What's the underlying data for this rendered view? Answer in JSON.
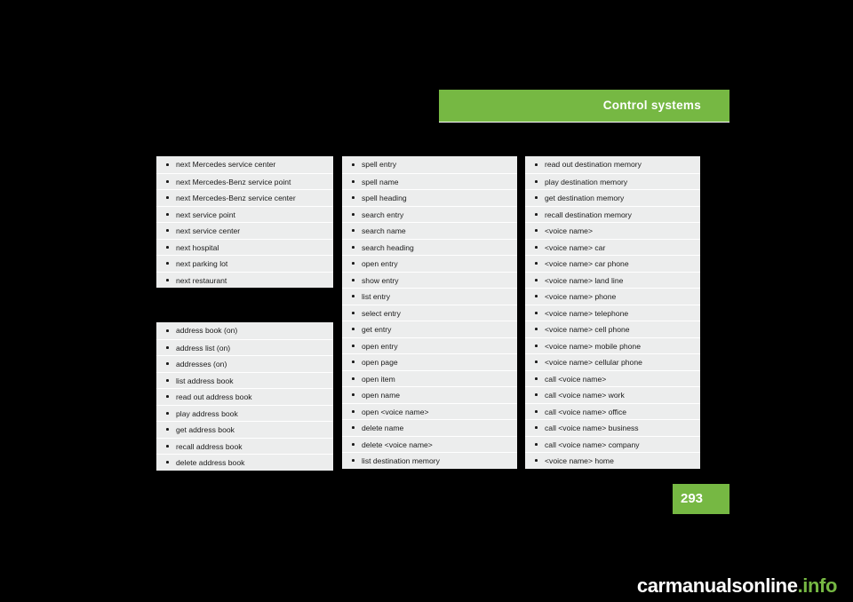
{
  "header": {
    "title": "Control systems"
  },
  "page_number": "293",
  "footer": {
    "text_main": "carmanualsonline",
    "text_suffix": ".info"
  },
  "tables": {
    "navigation_pois": [
      "next Mercedes service center",
      "next Mercedes-Benz service point",
      "next Mercedes-Benz service center",
      "next service point",
      "next service center",
      "next hospital",
      "next parking lot",
      "next restaurant"
    ],
    "address_book": [
      "address book (on)",
      "address list (on)",
      "addresses (on)",
      "list address book",
      "read out address book",
      "play address book",
      "get address book",
      "recall address book",
      "delete address book"
    ],
    "entry_commands": [
      "spell entry",
      "spell name",
      "spell heading",
      "search entry",
      "search name",
      "search heading",
      "open entry",
      "show entry",
      "list entry",
      "select entry",
      "get entry",
      "open entry",
      "open page",
      "open item",
      "open name",
      "open <voice name>",
      "delete name",
      "delete <voice name>",
      "list destination memory"
    ],
    "destination_memory": [
      "read out destination memory",
      "play destination memory",
      " get destination memory",
      "recall destination memory",
      "<voice name>",
      "<voice name> car",
      "<voice name> car phone",
      "<voice name> land line",
      "<voice name> phone",
      "<voice name> telephone",
      "<voice name> cell phone",
      "<voice name> mobile phone",
      "<voice name> cellular phone",
      "call <voice name>",
      "call <voice name> work",
      "call <voice name> office",
      "call <voice name> business",
      "call <voice name> company",
      "<voice name> home"
    ]
  }
}
